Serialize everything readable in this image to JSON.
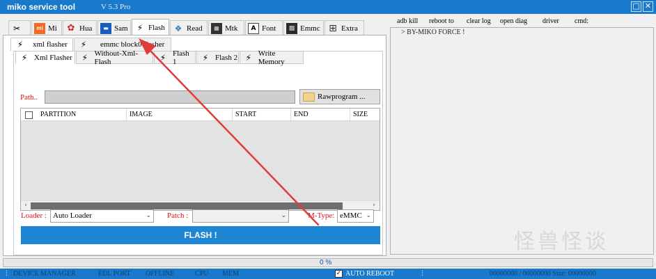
{
  "window": {
    "title": "miko service tool",
    "version": "V 5.3 Pro",
    "maximize_glyph": "□",
    "close_glyph": "✕"
  },
  "main_tabs": [
    {
      "label": "",
      "icon": "tools-icon"
    },
    {
      "label": "Mi",
      "icon": "mi-icon"
    },
    {
      "label": "Hua",
      "icon": "huawei-icon"
    },
    {
      "label": "Sam",
      "icon": "samsung-icon"
    },
    {
      "label": "Flash",
      "icon": "lightning-icon"
    },
    {
      "label": "Read",
      "icon": "read-icon"
    },
    {
      "label": "Mtk",
      "icon": "mtk-chip-icon"
    },
    {
      "label": "Font",
      "icon": "font-icon"
    },
    {
      "label": "Emmc",
      "icon": "emmc-chip-icon"
    },
    {
      "label": "Extra",
      "icon": "extra-icon"
    }
  ],
  "flash_subtabs": [
    {
      "label": "xml flasher"
    },
    {
      "label": "emmc block0 flasher"
    }
  ],
  "inner_tabs": [
    {
      "label": "Xml Flasher"
    },
    {
      "label": "Without-Xml-Flash"
    },
    {
      "label": "Flash 1"
    },
    {
      "label": "Flash 2"
    },
    {
      "label": "Write Memory"
    }
  ],
  "path": {
    "label": "Path..",
    "value": "",
    "button": "Rawprogram ..."
  },
  "table": {
    "columns": [
      "PARTITION",
      "IMAGE",
      "START",
      "END",
      "SIZE"
    ],
    "rows": []
  },
  "options": {
    "loader_label": "Loader :",
    "loader_value": "Auto Loader",
    "patch_label": "Patch :",
    "patch_value": "",
    "mtype_label": "M-Type:",
    "mtype_value": "eMMC"
  },
  "flash_button": "FLASH !",
  "cmd_menu": [
    "adb kill",
    "reboot to",
    "clear log",
    "open diag",
    "driver",
    "cmd:"
  ],
  "log_lines": [
    "> BY-MIKO FORCE !"
  ],
  "progress": {
    "text": "0 %",
    "value": 0
  },
  "statusbar": {
    "device_manager": "DEVICE MANAGER",
    "edl_port": "EDL PORT",
    "offline": "OFFLINE",
    "cpu": "CPU",
    "mem": "MEM",
    "auto_reboot": "AUTO REBOOT",
    "auto_reboot_checked": true,
    "check_glyph": "✓",
    "counters": "00000000 / 00000000 Size: 00000000"
  },
  "watermark": "怪兽怪谈",
  "accent_color": "#1979ca",
  "annotation_color": "#e23b3b"
}
